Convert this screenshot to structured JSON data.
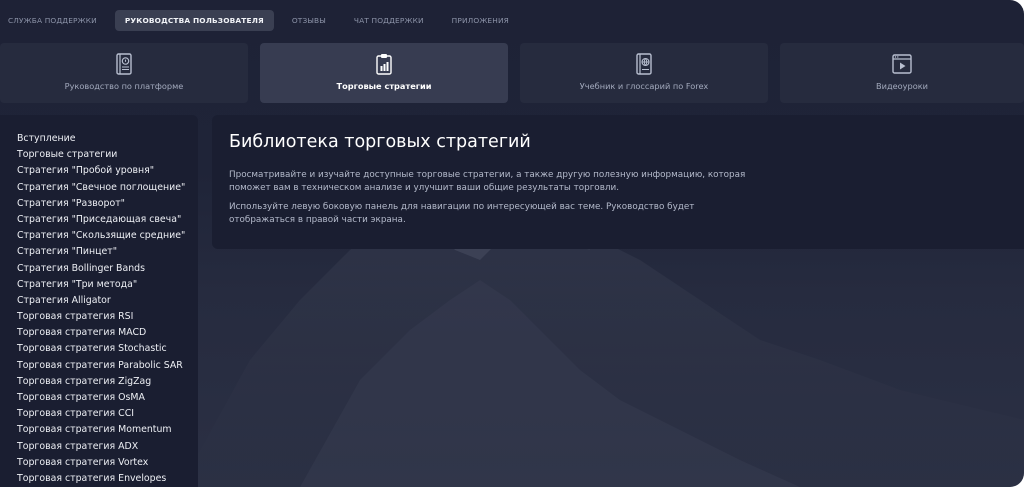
{
  "topnav": {
    "tabs": [
      {
        "label": "СЛУЖБА ПОДДЕРЖКИ",
        "active": false
      },
      {
        "label": "РУКОВОДСТВА ПОЛЬЗОВАТЕЛЯ",
        "active": true
      },
      {
        "label": "ОТЗЫВЫ",
        "active": false
      },
      {
        "label": "ЧАТ ПОДДЕРЖКИ",
        "active": false
      },
      {
        "label": "ПРИЛОЖЕНИЯ",
        "active": false
      }
    ]
  },
  "cards": [
    {
      "label": "Руководство по платформе",
      "icon": "platform-guide-icon",
      "active": false
    },
    {
      "label": "Торговые стратегии",
      "icon": "trading-strategies-icon",
      "active": true
    },
    {
      "label": "Учебник и глоссарий по Forex",
      "icon": "forex-glossary-icon",
      "active": false
    },
    {
      "label": "Видеоуроки",
      "icon": "video-lessons-icon",
      "active": false
    }
  ],
  "sidebar": {
    "items": [
      "Вступление",
      "Торговые стратегии",
      "Стратегия \"Пробой уровня\"",
      "Стратегия \"Свечное поглощение\"",
      "Стратегия \"Разворот\"",
      "Стратегия \"Приседающая свеча\"",
      "Стратегия \"Скользящие средние\"",
      "Стратегия \"Пинцет\"",
      "Стратегия Bollinger Bands",
      "Стратегия \"Три метода\"",
      "Стратегия Alligator",
      "Торговая стратегия RSI",
      "Торговая стратегия MACD",
      "Торговая стратегия Stochastic",
      "Торговая стратегия Parabolic SAR",
      "Торговая стратегия ZigZag",
      "Торговая стратегия OsMA",
      "Торговая стратегия CCI",
      "Торговая стратегия Momentum",
      "Торговая стратегия ADX",
      "Торговая стратегия Vortex",
      "Торговая стратегия Envelopes"
    ]
  },
  "main": {
    "title": "Библиотека торговых стратегий",
    "paragraph1": "Просматривайте и изучайте доступные торговые стратегии, а также другую полезную информацию, которая поможет вам в техническом анализе и улучшит ваши общие результаты торговли.",
    "paragraph2": "Используйте левую боковую панель для навигации по интересующей вас теме. Руководство будет отображаться в правой части экрана."
  },
  "colors": {
    "background": "#1f2438",
    "panel": "#1a1e31",
    "card": "#262b3e",
    "card_active": "#373c51",
    "tab_active": "#3a3f52"
  }
}
